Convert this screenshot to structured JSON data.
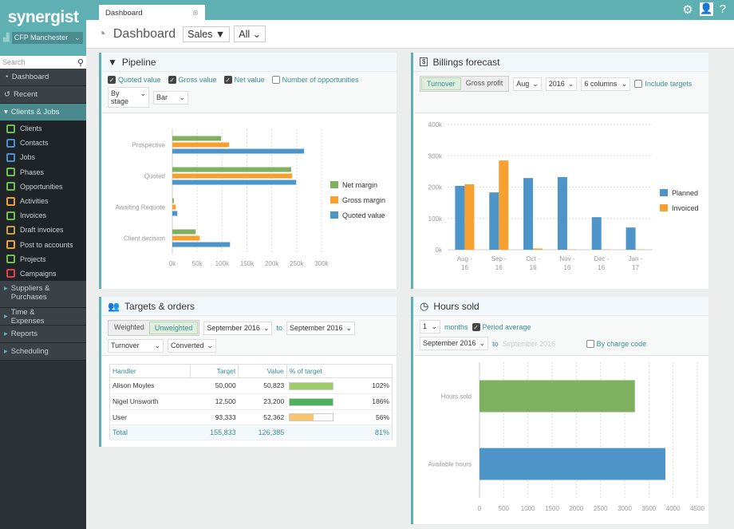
{
  "app": {
    "logo": "synergist",
    "office": "CFP Manchester",
    "search_placeholder": "Search"
  },
  "tab": {
    "label": "Dashboard"
  },
  "page": {
    "title": "Dashboard",
    "filter1": "Sales ▼",
    "filter2": "All"
  },
  "sidebar": {
    "top": [
      {
        "label": "Dashboard"
      },
      {
        "label": "Recent"
      },
      {
        "label": "Clients & Jobs"
      }
    ],
    "sub": [
      {
        "label": "Clients",
        "color": "#6fbf4a"
      },
      {
        "label": "Contacts",
        "color": "#4a90d0"
      },
      {
        "label": "Jobs",
        "color": "#4a90d0"
      },
      {
        "label": "Phases",
        "color": "#6fbf4a"
      },
      {
        "label": "Opportunities",
        "color": "#6fbf4a"
      },
      {
        "label": "Activities",
        "color": "#f0a030"
      },
      {
        "label": "Invoices",
        "color": "#6fbf4a"
      },
      {
        "label": "Draft invoices",
        "color": "#c9a040"
      },
      {
        "label": "Post to accounts",
        "color": "#f0a030"
      },
      {
        "label": "Projects",
        "color": "#6fbf4a"
      },
      {
        "label": "Campaigns",
        "color": "#e0404a"
      }
    ],
    "bottom": [
      {
        "label": "Suppliers & Purchases"
      },
      {
        "label": "Time & Expenses"
      },
      {
        "label": "Reports"
      },
      {
        "label": "Scheduling"
      }
    ]
  },
  "pipeline": {
    "title": "Pipeline",
    "checks": [
      {
        "label": "Quoted value",
        "on": true
      },
      {
        "label": "Gross value",
        "on": true
      },
      {
        "label": "Net value",
        "on": true
      },
      {
        "label": "Number of opportunities",
        "on": false
      }
    ],
    "group_by": "By stage",
    "chart_type": "Bar"
  },
  "billings": {
    "title": "Billings forecast",
    "seg": [
      "Turnover",
      "Gross profit"
    ],
    "month": "Aug",
    "year": "2016",
    "columns": "6 columns",
    "include_targets": "Include targets"
  },
  "targets": {
    "title": "Targets & orders",
    "seg": [
      "Weighted",
      "Unweighted"
    ],
    "from": "September 2016",
    "to_label": "to",
    "to": "September 2016",
    "measure": "Turnover",
    "status": "Converted",
    "headers": [
      "Handler",
      "Target",
      "Value",
      "% of target"
    ],
    "rows": [
      {
        "handler": "Alison Moyles",
        "target": "50,000",
        "value": "50,823",
        "pct": "102%",
        "fill": 102,
        "color": "#9fcb6b"
      },
      {
        "handler": "Nigel Unsworth",
        "target": "12,500",
        "value": "23,200",
        "pct": "186%",
        "fill": 186,
        "color": "#4cb35c"
      },
      {
        "handler": "User",
        "target": "93,333",
        "value": "52,362",
        "pct": "56%",
        "fill": 56,
        "color": "#f8c56a"
      }
    ],
    "total": {
      "label": "Total",
      "target": "155,833",
      "value": "126,385",
      "pct": "81%"
    }
  },
  "hours": {
    "title": "Hours sold",
    "months_value": "1",
    "months_label": "months",
    "period_average": "Period average",
    "from": "September 2016",
    "to_label": "to",
    "to": "September 2016",
    "by_charge_code": "By charge code"
  },
  "chart_data": [
    {
      "type": "bar",
      "orientation": "horizontal",
      "categories": [
        "Prospective",
        "Quoted",
        "Awaiting Requote",
        "Client decision"
      ],
      "series": [
        {
          "name": "Net margin",
          "color": "#7fb05f",
          "values": [
            98,
            239,
            3,
            47
          ]
        },
        {
          "name": "Gross margin",
          "color": "#f7a030",
          "values": [
            114,
            241,
            7,
            55
          ]
        },
        {
          "name": "Quoted value",
          "color": "#4d94c8",
          "values": [
            265,
            249,
            10,
            116
          ]
        }
      ],
      "xticks": [
        "0k",
        "50k",
        "100k",
        "150k",
        "200k",
        "250k",
        "300k"
      ],
      "xlim": [
        0,
        300
      ],
      "unit": "k",
      "legend": "right",
      "grid": true
    },
    {
      "type": "bar",
      "categories": [
        "Aug - 16",
        "Sep - 16",
        "Oct - 16",
        "Nov - 16",
        "Dec - 16",
        "Jan - 17"
      ],
      "series": [
        {
          "name": "Planned",
          "color": "#4d94c8",
          "values": [
            204,
            183,
            229,
            232,
            104,
            71
          ]
        },
        {
          "name": "Invoiced",
          "color": "#f7a030",
          "values": [
            209,
            285,
            4,
            1,
            1,
            1
          ]
        }
      ],
      "yticks": [
        "0k",
        "100k",
        "200k",
        "300k",
        "400k"
      ],
      "ylim": [
        0,
        400
      ],
      "unit": "k",
      "legend": "right",
      "grid": true
    },
    {
      "type": "bar",
      "orientation": "horizontal",
      "categories": [
        "Hours sold",
        "Available hours"
      ],
      "values": [
        3210,
        3840
      ],
      "colors": [
        "#7fb05f",
        "#4d94c8"
      ],
      "xticks": [
        "0",
        "500",
        "1000",
        "1500",
        "2000",
        "2500",
        "3000",
        "3500",
        "4000",
        "4500"
      ],
      "xlim": [
        0,
        4500
      ],
      "grid": true
    }
  ]
}
